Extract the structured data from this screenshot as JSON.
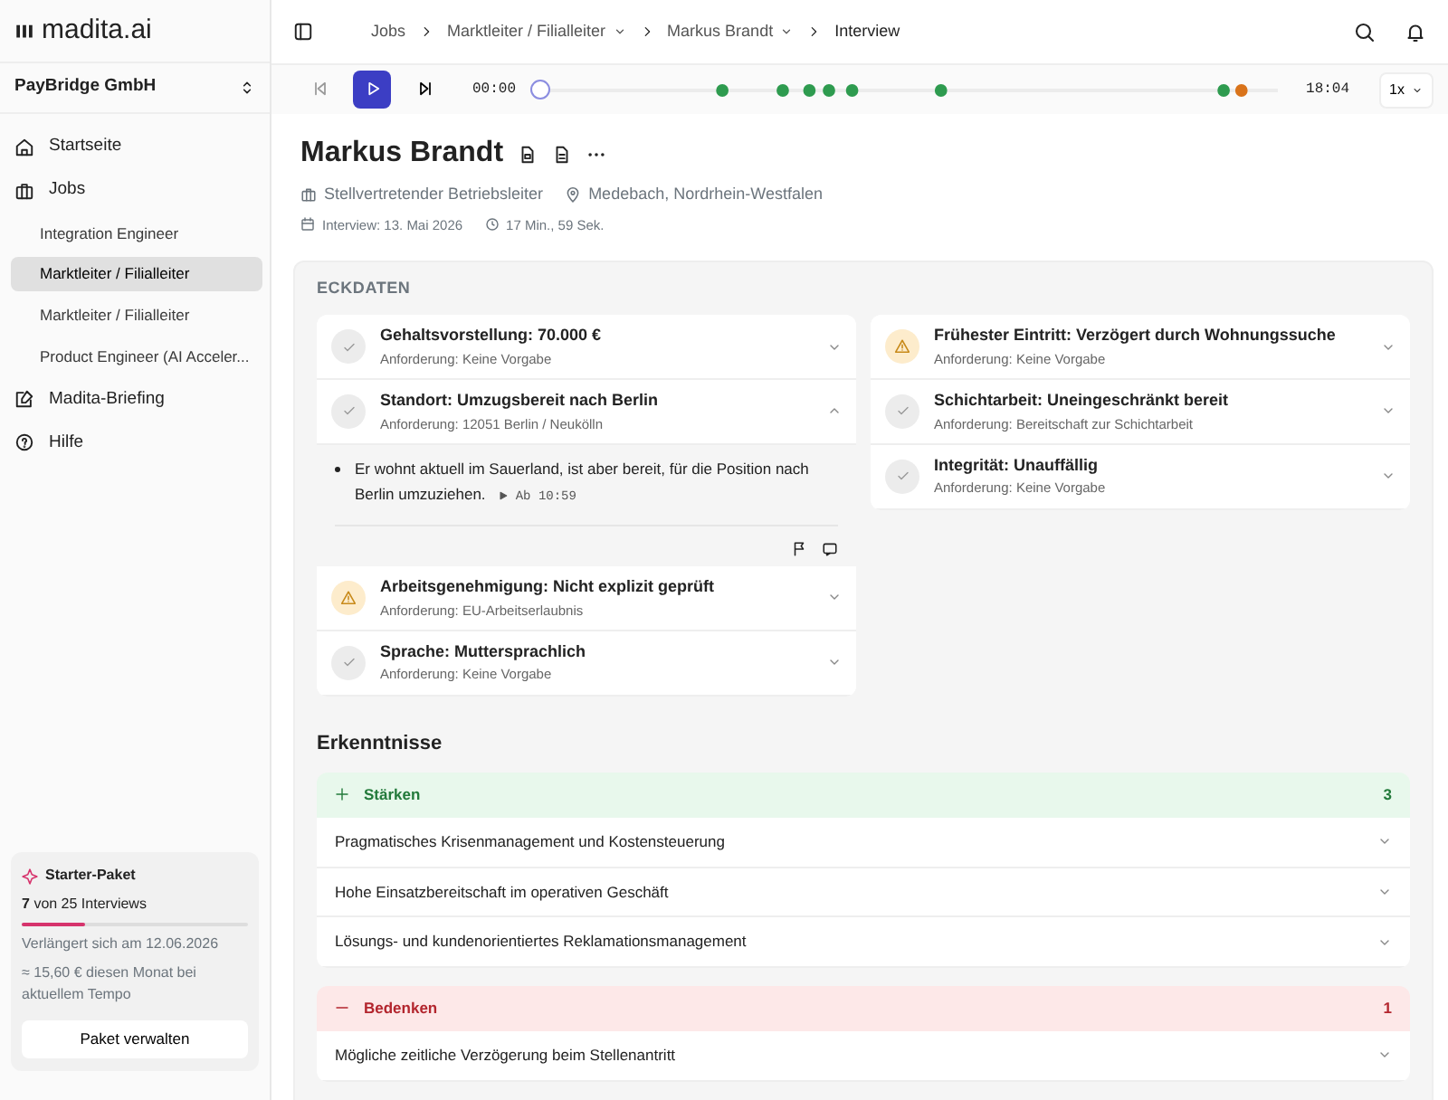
{
  "sidebar": {
    "logo": "madita.ai",
    "organization": "PayBridge GmbH",
    "nav": [
      {
        "label": "Startseite",
        "selected": false
      },
      {
        "label": "Jobs",
        "selected": false,
        "children": [
          {
            "label": "Integration Engineer",
            "selected": false
          },
          {
            "label": "Marktleiter / Filialleiter",
            "selected": true
          },
          {
            "label": "Marktleiter / Filialleiter",
            "selected": false
          },
          {
            "label": "Product Engineer (AI Acceler...",
            "selected": false
          }
        ]
      },
      {
        "label": "Madita-Briefing",
        "selected": false
      },
      {
        "label": "Hilfe",
        "selected": false
      }
    ],
    "plan": {
      "name": "Starter-Paket",
      "used": "7",
      "usage": "von 25 Interviews",
      "level": 0.28,
      "renewal": "Verlängert sich am 12.06.2026",
      "estimate": "≈ 15,60 € diesen Monat bei aktuellem Tempo",
      "button": "Paket verwalten"
    }
  },
  "breadcrumb": [
    {
      "label": "Jobs",
      "dropdown": false
    },
    {
      "label": "Marktleiter / Filialleiter",
      "dropdown": true
    },
    {
      "label": "Markus Brandt",
      "dropdown": true
    },
    {
      "label": "Interview",
      "dropdown": false
    }
  ],
  "player": {
    "start_time": "00:00",
    "end_time": "18:04",
    "level": 0,
    "speed": "1x"
  },
  "candidate": {
    "name": "Markus Brandt",
    "position": "Stellvertretender Betriebsleiter",
    "location": "Medebach, Nordrhein-Westfalen",
    "interview_date": "Interview:  13. Mai 2026",
    "duration": "17 Min., 59 Sek."
  },
  "key_facts": {
    "heading": "ECKDATEN",
    "columns": [
      [
        {
          "kind": "ok",
          "title": "Gehaltsvorstellung: 70.000 €",
          "requirement": "Anforderung: Keine Vorgabe",
          "expanded": false
        },
        {
          "kind": "ok",
          "title": "Standort: Umzugsbereit nach Berlin",
          "requirement": "Anforderung: 12051 Berlin / Neukölln",
          "expanded": true,
          "details": [
            {
              "text": "Er wohnt aktuell im Sauerland, ist aber bereit, für die Position nach Berlin umzuziehen.",
              "timestamp": "Ab 10:59"
            }
          ]
        },
        {
          "kind": "warning",
          "title": "Arbeitsgenehmigung: Nicht explizit geprüft",
          "requirement": "Anforderung: EU-Arbeitserlaubnis",
          "expanded": false
        },
        {
          "kind": "ok",
          "title": "Sprache: Muttersprachlich",
          "requirement": "Anforderung: Keine Vorgabe",
          "expanded": false
        }
      ],
      [
        {
          "kind": "warning",
          "title": "Frühester Eintritt: Verzögert durch Wohnungssuche",
          "requirement": "Anforderung: Keine Vorgabe",
          "expanded": false
        },
        {
          "kind": "ok",
          "title": "Schichtarbeit: Uneingeschränkt bereit",
          "requirement": "Anforderung: Bereitschaft zur Schichtarbeit",
          "expanded": false
        },
        {
          "kind": "ok",
          "title": "Integrität: Unauffällig",
          "requirement": "Anforderung: Keine Vorgabe",
          "expanded": false
        }
      ]
    ]
  },
  "insights": {
    "heading": "Erkenntnisse",
    "groups": [
      {
        "kind": "strengths",
        "label": "Stärken",
        "count": "3",
        "items": [
          {
            "text": "Pragmatisches Krisenmanagement und Kostensteuerung",
            "expanded": false
          },
          {
            "text": "Hohe Einsatzbereitschaft im operativen Geschäft",
            "expanded": false
          },
          {
            "text": "Lösungs- und kundenorientiertes Reklamationsmanagement",
            "expanded": false
          }
        ]
      },
      {
        "kind": "concerns",
        "label": "Bedenken",
        "count": "1",
        "items": [
          {
            "text": "Mögliche zeitliche Verzögerung beim Stellenantritt",
            "expanded": false
          }
        ]
      }
    ]
  }
}
